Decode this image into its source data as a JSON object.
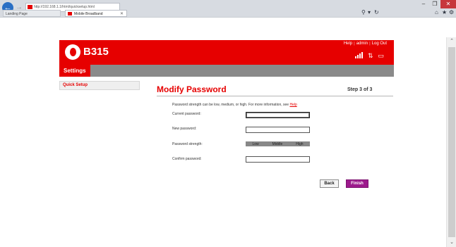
{
  "browser": {
    "address": "http://192.168.1.1/html/quicksetup.html",
    "tabs": [
      {
        "label": "Landing Page"
      },
      {
        "label": "Mobile Broadband"
      }
    ]
  },
  "header": {
    "brand": "B315",
    "links": {
      "help": "Help",
      "admin": "admin",
      "logout": "Log Out"
    }
  },
  "nav": {
    "settings": "Settings"
  },
  "sidebar": {
    "items": [
      {
        "label": "Quick Setup"
      }
    ]
  },
  "main": {
    "title": "Modify Password",
    "step": "Step 3 of 3",
    "hint": "Password strength can be low, medium, or high. For more information, see",
    "hint_link": "Help",
    "fields": {
      "current": {
        "label": "Current password:",
        "value": ""
      },
      "new": {
        "label": "New password:",
        "value": ""
      },
      "strength": {
        "label": "Password strength:",
        "levels": [
          "Low",
          "Middle",
          "High"
        ]
      },
      "confirm": {
        "label": "Confirm password:",
        "value": ""
      }
    },
    "buttons": {
      "back": "Back",
      "finish": "Finish"
    }
  },
  "colors": {
    "brand_red": "#e60000",
    "nav_gray": "#8a8a8a",
    "finish_purple": "#9c1a8c"
  }
}
